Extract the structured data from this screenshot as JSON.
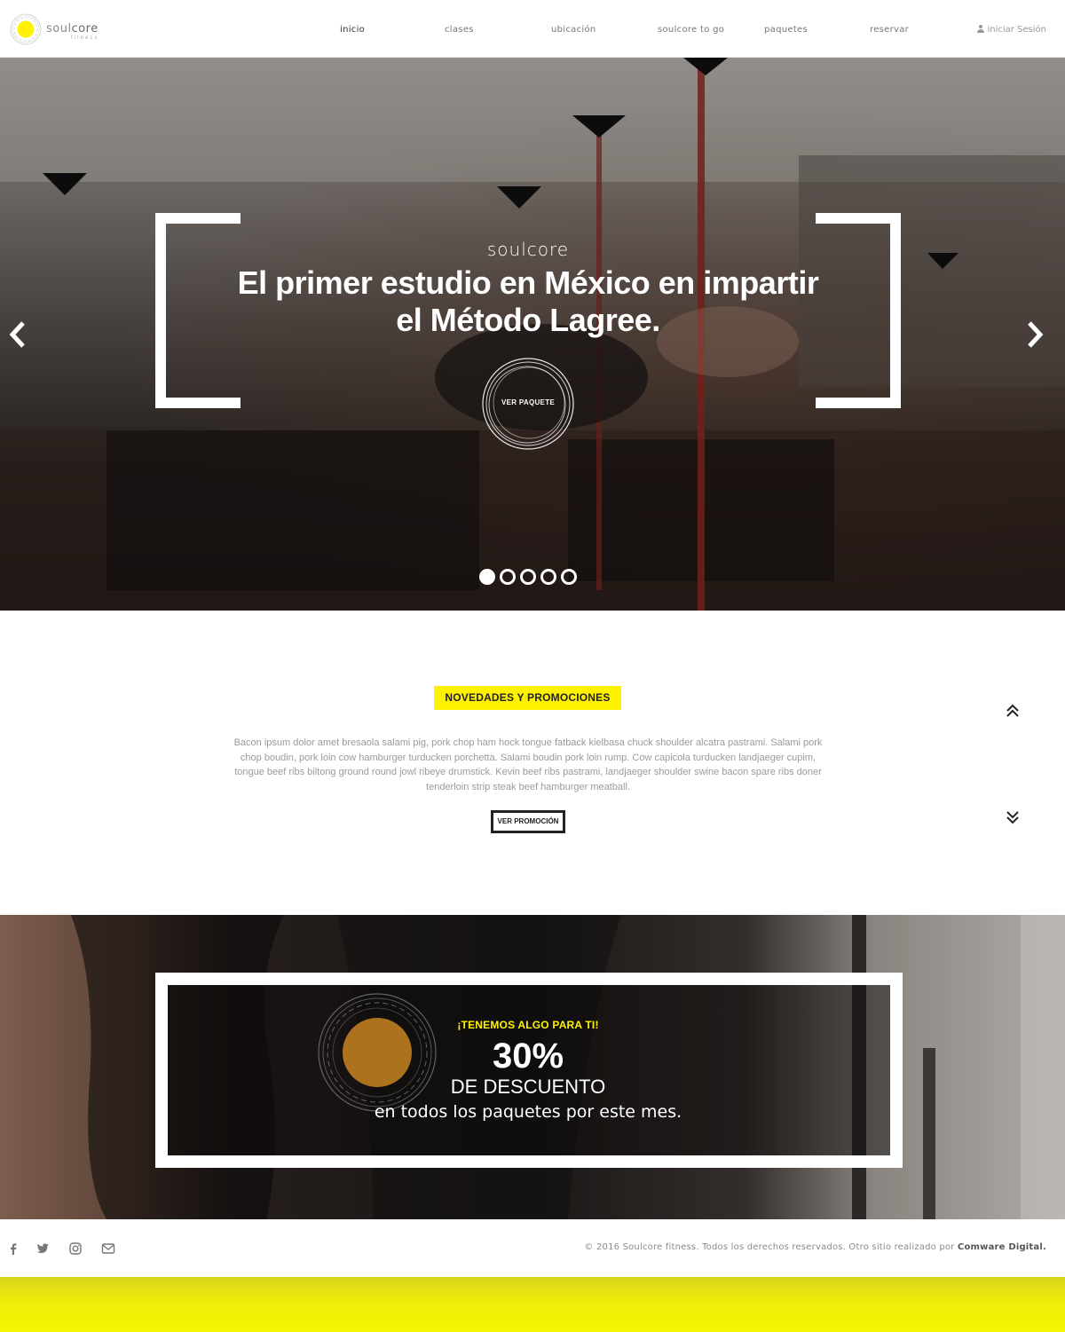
{
  "brand": {
    "name_part1": "soul",
    "name_part2": "core",
    "tagline": "fitness",
    "accent_color": "#fff200"
  },
  "nav": {
    "items": [
      {
        "label": "inicio",
        "active": true
      },
      {
        "label": "clases"
      },
      {
        "label": "ubicación"
      },
      {
        "label": "soulcore to go"
      },
      {
        "label": "paquetes"
      },
      {
        "label": "reservar"
      }
    ],
    "login_label": "iniciar Sesión",
    "login_icon": "user-icon"
  },
  "hero": {
    "kicker": "soulcore",
    "title_line1": "El primer estudio en México en impartir",
    "title_line2": "el Método Lagree.",
    "cta_label": "VER PAQUETE",
    "slide_count": 5,
    "active_slide": 1,
    "prev_icon": "chevron-left-icon",
    "next_icon": "chevron-right-icon"
  },
  "promo": {
    "tag": "NOVEDADES Y PROMOCIONES",
    "body": "Bacon ipsum dolor amet bresaola salami pig, pork chop ham hock tongue fatback kielbasa chuck shoulder alcatra pastrami. Salami pork chop boudin, pork loin cow hamburger turducken porchetta. Salami boudin pork loin rump. Cow capicola turducken landjaeger cupim, tongue beef ribs biltong ground round jowl ribeye drumstick. Kevin beef ribs pastrami, landjaeger shoulder swine bacon spare ribs doner tenderloin strip steak beef hamburger meatball.",
    "button_label": "VER PROMOCIÓN",
    "up_icon": "double-chevron-up-icon",
    "down_icon": "double-chevron-down-icon"
  },
  "banner": {
    "kicker": "¡TENEMOS ALGO PARA TI!",
    "big": "30%",
    "sub": "DE DESCUENTO",
    "sub2": "en todos los paquetes por este mes."
  },
  "footer": {
    "social_icons": [
      "facebook-icon",
      "twitter-icon",
      "instagram-icon",
      "mail-icon"
    ],
    "copyright": "© 2016 Soulcore fitness. Todos los derechos reservados. Otro sitio realizado por ",
    "credit": "Comware Digital."
  }
}
